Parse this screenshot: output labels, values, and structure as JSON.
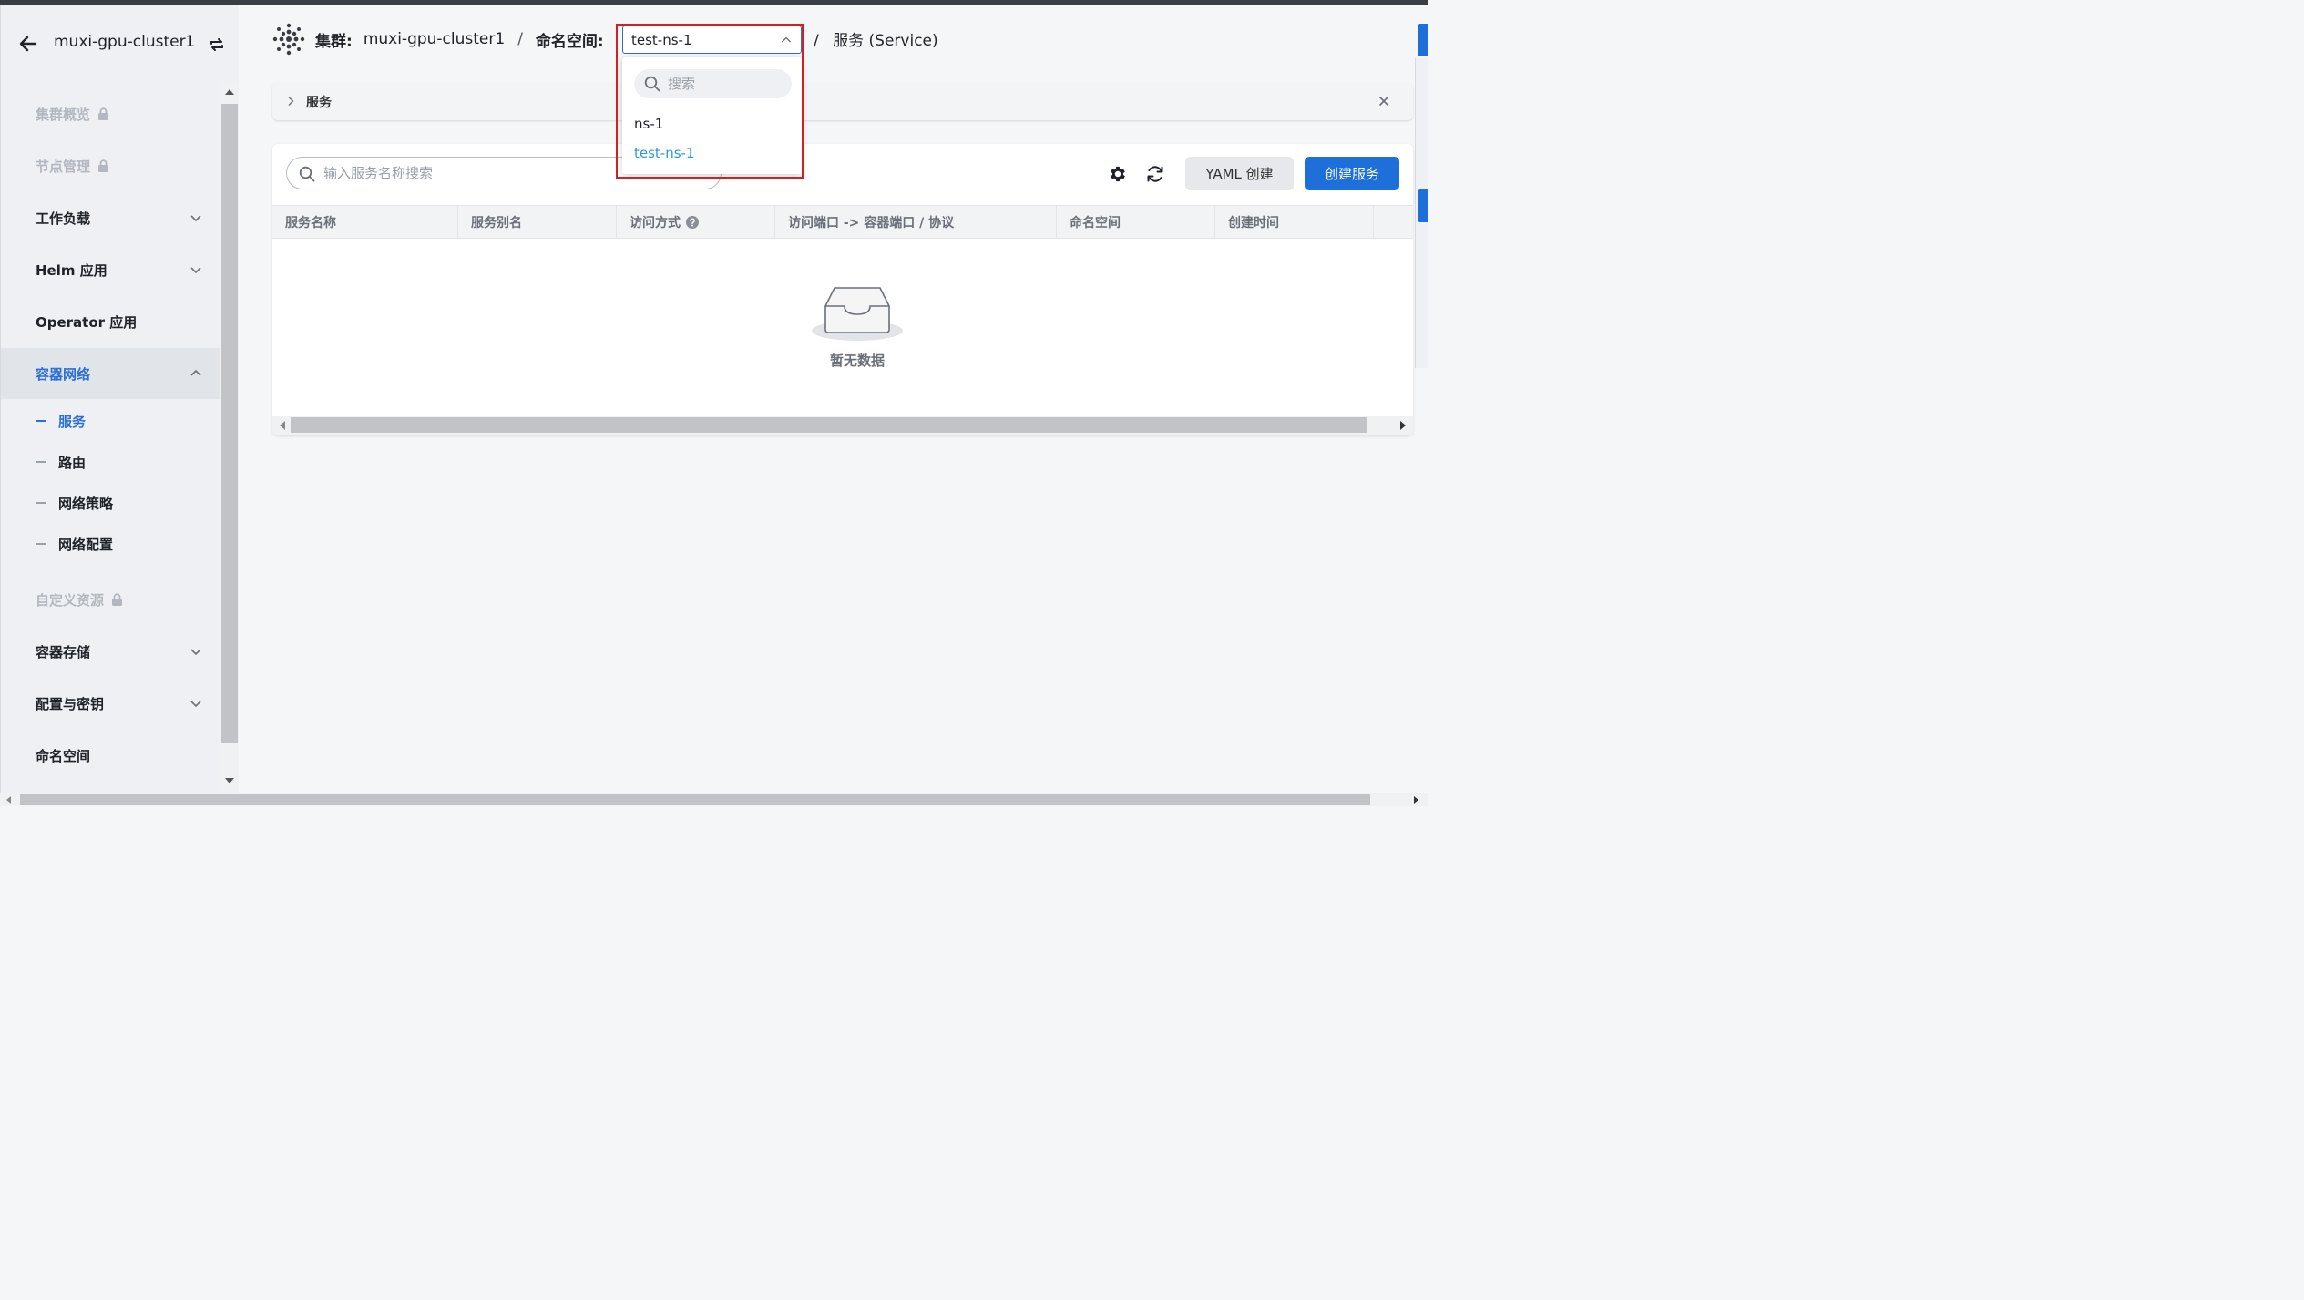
{
  "sidebar": {
    "cluster_name": "muxi-gpu-cluster1",
    "items": [
      {
        "label": "集群概览",
        "disabled": true
      },
      {
        "label": "节点管理",
        "disabled": true
      },
      {
        "label": "工作负载"
      },
      {
        "label": "Helm 应用"
      },
      {
        "label": "Operator 应用"
      },
      {
        "label": "容器网络",
        "active": true
      },
      {
        "label": "自定义资源",
        "disabled": true
      },
      {
        "label": "容器存储"
      },
      {
        "label": "配置与密钥"
      },
      {
        "label": "命名空间"
      }
    ],
    "sub_items": [
      {
        "label": "服务",
        "active": true
      },
      {
        "label": "路由"
      },
      {
        "label": "网络策略"
      },
      {
        "label": "网络配置"
      }
    ]
  },
  "header": {
    "cluster_label": "集群:",
    "cluster_value": "muxi-gpu-cluster1",
    "separator": "/",
    "namespace_label": "命名空间:",
    "namespace_value": "test-ns-1",
    "page_crumb": "服务 (Service)"
  },
  "namespace_dropdown": {
    "search_placeholder": "搜索",
    "options": [
      "ns-1",
      "test-ns-1"
    ],
    "selected": "test-ns-1"
  },
  "notice": {
    "title": "服务"
  },
  "toolbar": {
    "search_placeholder": "输入服务名称搜索",
    "yaml_create_label": "YAML 创建",
    "create_service_label": "创建服务"
  },
  "table": {
    "columns": [
      "服务名称",
      "服务别名",
      "访问方式",
      "访问端口 -> 容器端口 / 协议",
      "命名空间",
      "创建时间"
    ],
    "rows": [],
    "empty_text": "暂无数据"
  },
  "colors": {
    "accent": "#1e6fd9",
    "active_nav": "#2a6fd6",
    "selected_option": "#2a9bd6",
    "highlight_border": "#d42020"
  }
}
